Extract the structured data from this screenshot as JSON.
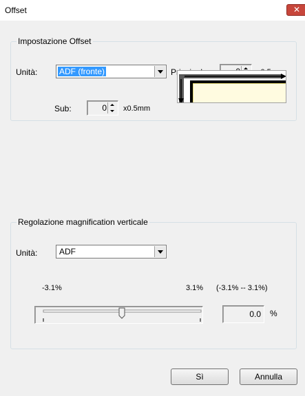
{
  "window": {
    "title": "Offset",
    "close_label": "✕"
  },
  "offset_group": {
    "legend": "Impostazione Offset",
    "unit_label": "Unità:",
    "unit_value": "ADF (fronte)",
    "main_label": "Principale:",
    "main_value": "0",
    "main_suffix": "x0.5mm",
    "sub_label": "Sub:",
    "sub_value": "0",
    "sub_suffix": "x0.5mm"
  },
  "magnification_group": {
    "legend": "Regolazione magnification verticale",
    "unit_label": "Unità:",
    "unit_value": "ADF",
    "min_label": "-3.1%",
    "max_label": "3.1%",
    "range_label": "(-3.1% -- 3.1%)",
    "slider_value_fraction": 0.5,
    "value": "0.0",
    "value_unit": "%"
  },
  "buttons": {
    "yes": "Sì",
    "cancel": "Annulla"
  },
  "icons": {
    "close": "close-icon",
    "dropdown": "chevron-down-icon"
  },
  "colors": {
    "selection": "#3399ff",
    "close_button": "#c7463b"
  }
}
